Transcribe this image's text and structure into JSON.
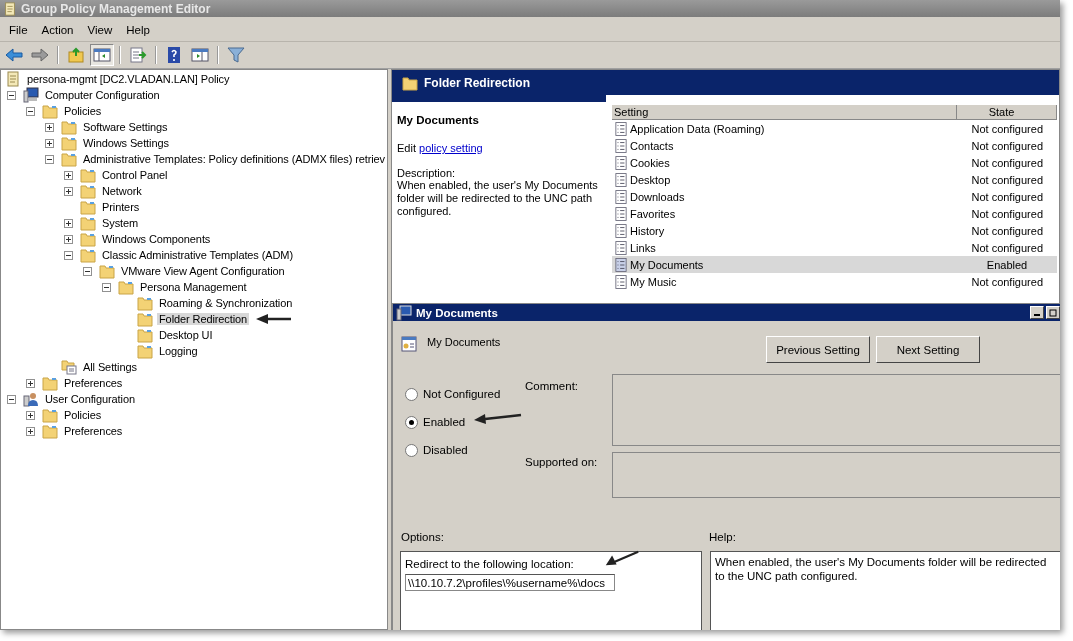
{
  "window": {
    "title": "Group Policy Management Editor"
  },
  "menu": [
    "File",
    "Action",
    "View",
    "Help"
  ],
  "toolbar": [
    {
      "kind": "back",
      "pressed": false
    },
    {
      "kind": "forward",
      "pressed": false
    },
    {
      "kind": "up",
      "pressed": false
    },
    {
      "kind": "tree",
      "pressed": true
    },
    {
      "kind": "export",
      "pressed": false
    },
    {
      "kind": "help",
      "pressed": false
    },
    {
      "kind": "actionpane",
      "pressed": false
    },
    {
      "kind": "filter",
      "pressed": false
    }
  ],
  "tree": [
    {
      "label": "persona-mgmt [DC2.VLADAN.LAN] Policy",
      "kind": "policy",
      "selected": false
    },
    {
      "label": "Computer Configuration",
      "kind": "computer",
      "expanded": true,
      "selected": false,
      "children": [
        {
          "label": "Policies",
          "kind": "folder",
          "expanded": true,
          "selected": false,
          "children": [
            {
              "label": "Software Settings",
              "kind": "folder",
              "expanded": false,
              "selected": false
            },
            {
              "label": "Windows Settings",
              "kind": "folder",
              "expanded": false,
              "selected": false
            },
            {
              "label": "Administrative Templates: Policy definitions (ADMX files) retriev",
              "kind": "folder",
              "expanded": true,
              "selected": false,
              "children": [
                {
                  "label": "Control Panel",
                  "kind": "folder",
                  "expanded": false,
                  "selected": false
                },
                {
                  "label": "Network",
                  "kind": "folder",
                  "expanded": false,
                  "selected": false
                },
                {
                  "label": "Printers",
                  "kind": "leaf",
                  "selected": false
                },
                {
                  "label": "System",
                  "kind": "folder",
                  "expanded": false,
                  "selected": false
                },
                {
                  "label": "Windows Components",
                  "kind": "folder",
                  "expanded": false,
                  "selected": false
                },
                {
                  "label": "Classic Administrative Templates (ADM)",
                  "kind": "folder",
                  "expanded": true,
                  "selected": false,
                  "children": [
                    {
                      "label": "VMware View Agent Configuration",
                      "kind": "folder",
                      "expanded": true,
                      "selected": false,
                      "children": [
                        {
                          "label": "Persona Management",
                          "kind": "folder",
                          "expanded": true,
                          "selected": false,
                          "children": [
                            {
                              "label": "Roaming & Synchronization",
                              "kind": "leaf",
                              "selected": false
                            },
                            {
                              "label": "Folder Redirection",
                              "kind": "leaf",
                              "selected": true
                            },
                            {
                              "label": "Desktop UI",
                              "kind": "leaf",
                              "selected": false
                            },
                            {
                              "label": "Logging",
                              "kind": "leaf",
                              "selected": false
                            }
                          ]
                        }
                      ]
                    }
                  ]
                }
              ]
            },
            {
              "label": "All Settings",
              "kind": "settings",
              "selected": false
            }
          ]
        },
        {
          "label": "Preferences",
          "kind": "folder",
          "expanded": false,
          "selected": false
        }
      ]
    },
    {
      "label": "User Configuration",
      "kind": "user",
      "expanded": true,
      "selected": false,
      "children": [
        {
          "label": "Policies",
          "kind": "folder",
          "expanded": false,
          "selected": false
        },
        {
          "label": "Preferences",
          "kind": "folder",
          "expanded": false,
          "selected": false
        }
      ]
    }
  ],
  "details": {
    "header": "Folder Redirection",
    "setting_title": "My Documents",
    "edit_prefix": "Edit",
    "edit_link": "policy setting ",
    "description_label": "Description:",
    "description": "When enabled, the user's My Documents folder will be redirected to the UNC path configured."
  },
  "settings_table": {
    "columns": [
      "Setting",
      "State"
    ],
    "rows": [
      {
        "name": "Application Data (Roaming)",
        "state": "Not configured",
        "selected": false
      },
      {
        "name": "Contacts",
        "state": "Not configured",
        "selected": false
      },
      {
        "name": "Cookies",
        "state": "Not configured",
        "selected": false
      },
      {
        "name": "Desktop",
        "state": "Not configured",
        "selected": false
      },
      {
        "name": "Downloads",
        "state": "Not configured",
        "selected": false
      },
      {
        "name": "Favorites",
        "state": "Not configured",
        "selected": false
      },
      {
        "name": "History",
        "state": "Not configured",
        "selected": false
      },
      {
        "name": "Links",
        "state": "Not configured",
        "selected": false
      },
      {
        "name": "My Documents",
        "state": "Enabled",
        "selected": true
      },
      {
        "name": "My Music",
        "state": "Not configured",
        "selected": false
      }
    ]
  },
  "dialog": {
    "title": "My Documents",
    "setting_name": "My Documents",
    "buttons": [
      "Previous Setting",
      "Next Setting"
    ],
    "radios": [
      {
        "label": "Not Configured",
        "selected": false
      },
      {
        "label": "Enabled",
        "selected": true
      },
      {
        "label": "Disabled",
        "selected": false
      }
    ],
    "comment_label": "Comment:",
    "supported_label": "Supported on:",
    "options_label": "Options:",
    "help_label": "Help:",
    "option_label": "Redirect to the following location:",
    "option_value": "\\\\10.10.7.2\\profiles\\%username%\\docs",
    "help_text": "When enabled, the user's My Documents folder will be redirected to the UNC path configured."
  }
}
